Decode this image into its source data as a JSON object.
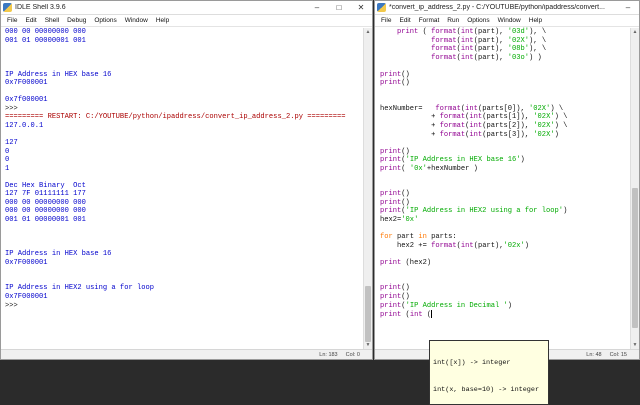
{
  "shell": {
    "title": "IDLE Shell 3.9.6",
    "menu": [
      "File",
      "Edit",
      "Shell",
      "Debug",
      "Options",
      "Window",
      "Help"
    ],
    "lines": [
      {
        "t": "000 00 00000000 000",
        "c": "o"
      },
      {
        "t": "001 01 00000001 001",
        "c": "o"
      },
      {
        "t": "",
        "c": ""
      },
      {
        "t": "",
        "c": ""
      },
      {
        "t": "",
        "c": ""
      },
      {
        "t": "IP Address in HEX base 16",
        "c": "o"
      },
      {
        "t": "0x7F000001",
        "c": "o"
      },
      {
        "t": "",
        "c": ""
      },
      {
        "t": "0x7f000001",
        "c": "o"
      },
      {
        "t": ">>>",
        "c": ""
      },
      {
        "t": "========= RESTART: C:/YOUTUBE/python/ipaddress/convert_ip_address_2.py =========",
        "c": "r"
      },
      {
        "t": "127.0.0.1",
        "c": "o"
      },
      {
        "t": "",
        "c": ""
      },
      {
        "t": "127",
        "c": "o"
      },
      {
        "t": "0",
        "c": "o"
      },
      {
        "t": "0",
        "c": "o"
      },
      {
        "t": "1",
        "c": "o"
      },
      {
        "t": "",
        "c": ""
      },
      {
        "t": "Dec Hex Binary  Oct",
        "c": "o"
      },
      {
        "t": "127 7F 01111111 177",
        "c": "o"
      },
      {
        "t": "000 00 00000000 000",
        "c": "o"
      },
      {
        "t": "000 00 00000000 000",
        "c": "o"
      },
      {
        "t": "001 01 00000001 001",
        "c": "o"
      },
      {
        "t": "",
        "c": ""
      },
      {
        "t": "",
        "c": ""
      },
      {
        "t": "",
        "c": ""
      },
      {
        "t": "IP Address in HEX base 16",
        "c": "o"
      },
      {
        "t": "0x7F000001",
        "c": "o"
      },
      {
        "t": "",
        "c": ""
      },
      {
        "t": "",
        "c": ""
      },
      {
        "t": "IP Address in HEX2 using a for loop",
        "c": "o"
      },
      {
        "t": "0x7F000001",
        "c": "o"
      },
      {
        "t": ">>>",
        "c": ""
      }
    ],
    "status": {
      "line": "Ln: 183",
      "col": "Col: 0"
    }
  },
  "editor": {
    "title": "*convert_ip_address_2.py - C:/YOUTUBE/python/ipaddress/convert...",
    "menu": [
      "File",
      "Edit",
      "Format",
      "Run",
      "Options",
      "Window",
      "Help"
    ],
    "lines": [
      [
        [
          "    ",
          ""
        ],
        [
          "print",
          "bi"
        ],
        [
          " ( ",
          ""
        ],
        [
          "format",
          "bi"
        ],
        [
          "(",
          ""
        ],
        [
          "int",
          "bi"
        ],
        [
          "(part), ",
          ""
        ],
        [
          "'03d'",
          "st"
        ],
        [
          "), \\",
          ""
        ]
      ],
      [
        [
          "            ",
          ""
        ],
        [
          "format",
          "bi"
        ],
        [
          "(",
          ""
        ],
        [
          "int",
          "bi"
        ],
        [
          "(part), ",
          ""
        ],
        [
          "'02X'",
          "st"
        ],
        [
          "), \\",
          ""
        ]
      ],
      [
        [
          "            ",
          ""
        ],
        [
          "format",
          "bi"
        ],
        [
          "(",
          ""
        ],
        [
          "int",
          "bi"
        ],
        [
          "(part), ",
          ""
        ],
        [
          "'08b'",
          "st"
        ],
        [
          "), \\",
          ""
        ]
      ],
      [
        [
          "            ",
          ""
        ],
        [
          "format",
          "bi"
        ],
        [
          "(",
          ""
        ],
        [
          "int",
          "bi"
        ],
        [
          "(part), ",
          ""
        ],
        [
          "'03o'",
          "st"
        ],
        [
          ") )",
          ""
        ]
      ],
      [
        [
          "",
          ""
        ]
      ],
      [
        [
          "print",
          "bi"
        ],
        [
          "()",
          ""
        ]
      ],
      [
        [
          "print",
          "bi"
        ],
        [
          "()",
          ""
        ]
      ],
      [
        [
          "",
          ""
        ]
      ],
      [
        [
          "",
          ""
        ]
      ],
      [
        [
          "hexNumber=   ",
          ""
        ],
        [
          "format",
          "bi"
        ],
        [
          "(",
          ""
        ],
        [
          "int",
          "bi"
        ],
        [
          "(parts[0]), ",
          ""
        ],
        [
          "'02X'",
          "st"
        ],
        [
          ") \\",
          ""
        ]
      ],
      [
        [
          "            + ",
          ""
        ],
        [
          "format",
          "bi"
        ],
        [
          "(",
          ""
        ],
        [
          "int",
          "bi"
        ],
        [
          "(parts[1]), ",
          ""
        ],
        [
          "'02X'",
          "st"
        ],
        [
          ") \\",
          ""
        ]
      ],
      [
        [
          "            + ",
          ""
        ],
        [
          "format",
          "bi"
        ],
        [
          "(",
          ""
        ],
        [
          "int",
          "bi"
        ],
        [
          "(parts[2]), ",
          ""
        ],
        [
          "'02X'",
          "st"
        ],
        [
          ") \\",
          ""
        ]
      ],
      [
        [
          "            + ",
          ""
        ],
        [
          "format",
          "bi"
        ],
        [
          "(",
          ""
        ],
        [
          "int",
          "bi"
        ],
        [
          "(parts[3]), ",
          ""
        ],
        [
          "'02X'",
          "st"
        ],
        [
          ")",
          ""
        ]
      ],
      [
        [
          "",
          ""
        ]
      ],
      [
        [
          "print",
          "bi"
        ],
        [
          "()",
          ""
        ]
      ],
      [
        [
          "print",
          "bi"
        ],
        [
          "(",
          ""
        ],
        [
          "'IP Address in HEX base 16'",
          "st"
        ],
        [
          ")",
          ""
        ]
      ],
      [
        [
          "print",
          "bi"
        ],
        [
          "( ",
          ""
        ],
        [
          "'0x'",
          "st"
        ],
        [
          "+hexNumber )",
          ""
        ]
      ],
      [
        [
          "",
          ""
        ]
      ],
      [
        [
          "",
          ""
        ]
      ],
      [
        [
          "print",
          "bi"
        ],
        [
          "()",
          ""
        ]
      ],
      [
        [
          "print",
          "bi"
        ],
        [
          "()",
          ""
        ]
      ],
      [
        [
          "print",
          "bi"
        ],
        [
          "(",
          ""
        ],
        [
          "'IP Address in HEX2 using a for loop'",
          "st"
        ],
        [
          ")",
          ""
        ]
      ],
      [
        [
          "hex2=",
          ""
        ],
        [
          "'0x'",
          "st"
        ]
      ],
      [
        [
          "",
          ""
        ]
      ],
      [
        [
          "for",
          "kw"
        ],
        [
          " part ",
          ""
        ],
        [
          "in",
          "kw"
        ],
        [
          " parts:",
          ""
        ]
      ],
      [
        [
          "    hex2 += ",
          ""
        ],
        [
          "format",
          "bi"
        ],
        [
          "(",
          ""
        ],
        [
          "int",
          "bi"
        ],
        [
          "(part),",
          ""
        ],
        [
          "'02x'",
          "st"
        ],
        [
          ")",
          ""
        ]
      ],
      [
        [
          "",
          ""
        ]
      ],
      [
        [
          "print",
          "bi"
        ],
        [
          " (hex2)",
          ""
        ]
      ],
      [
        [
          "",
          ""
        ]
      ],
      [
        [
          "",
          ""
        ]
      ],
      [
        [
          "print",
          "bi"
        ],
        [
          "()",
          ""
        ]
      ],
      [
        [
          "print",
          "bi"
        ],
        [
          "()",
          ""
        ]
      ],
      [
        [
          "print",
          "bi"
        ],
        [
          "(",
          ""
        ],
        [
          "'IP Address in Decimal '",
          "st"
        ],
        [
          ")",
          ""
        ]
      ],
      [
        [
          "print",
          "bi"
        ],
        [
          " (",
          ""
        ],
        [
          "int",
          "bi"
        ],
        [
          " (",
          ""
        ]
      ]
    ],
    "tooltip": [
      "int([x]) -> integer",
      "int(x, base=10) -> integer"
    ],
    "status": {
      "line": "Ln: 48",
      "col": "Col: 15"
    }
  },
  "colors": {
    "output": "#0000cc",
    "restart": "#aa0000",
    "keyword": "#ff7700",
    "builtin": "#900090",
    "string": "#00aa00"
  }
}
